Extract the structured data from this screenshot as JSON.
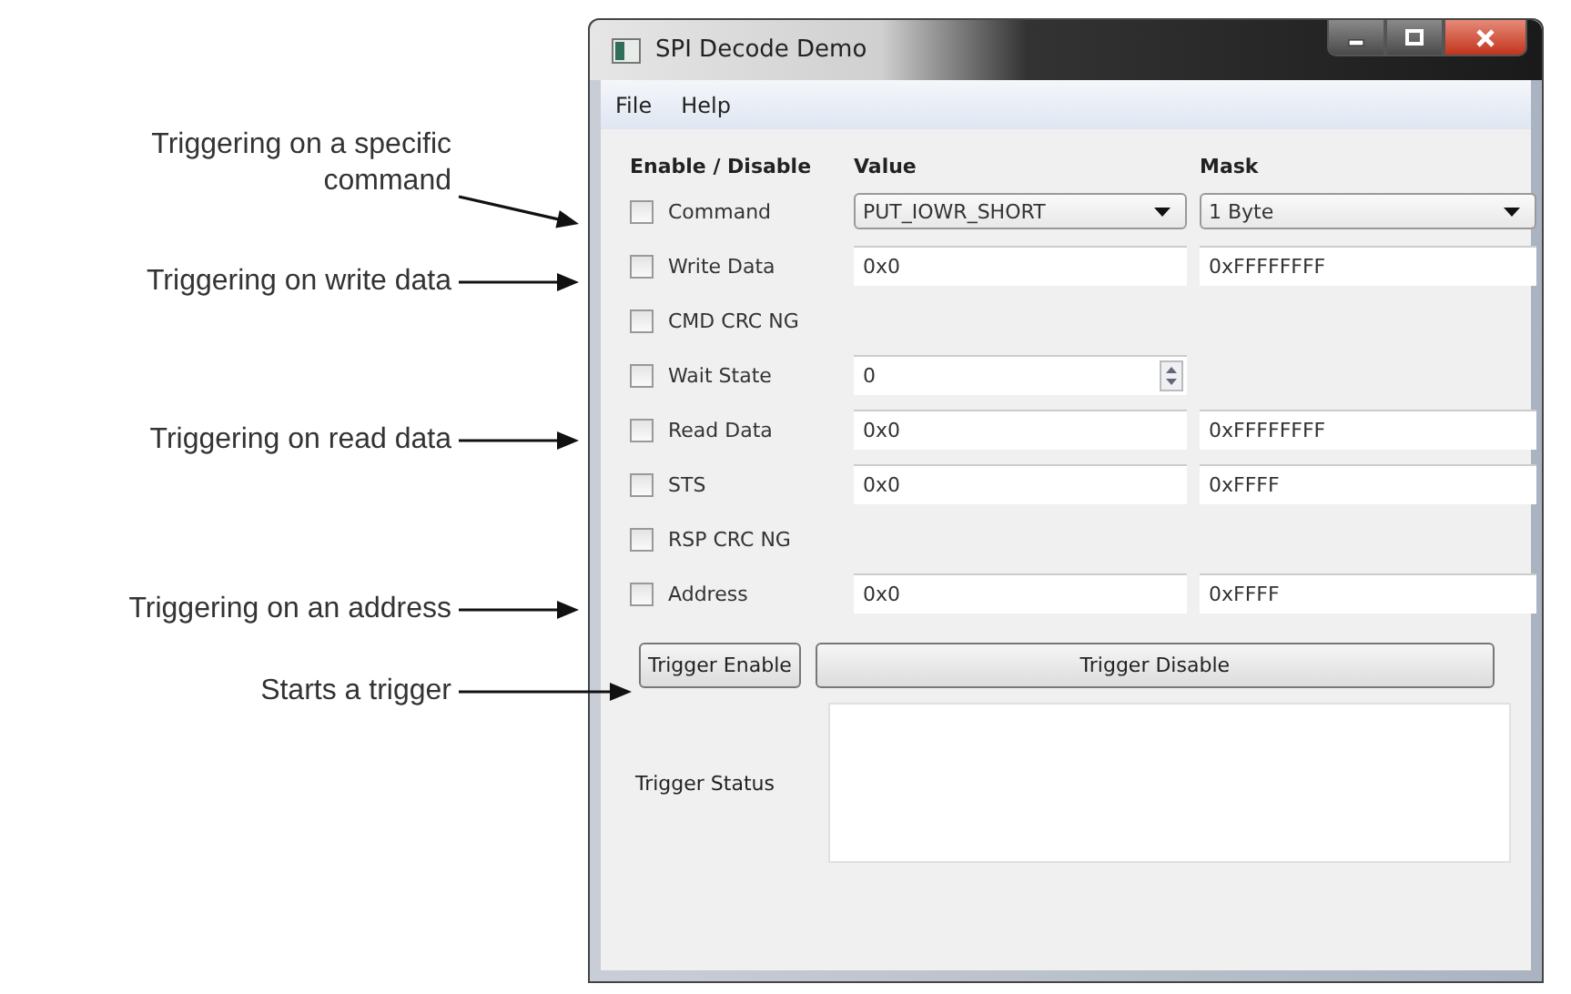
{
  "callouts": [
    {
      "text": "Triggering on a specific command"
    },
    {
      "text": "Triggering on write data"
    },
    {
      "text": "Triggering on read data"
    },
    {
      "text": "Triggering on an address"
    },
    {
      "text": "Starts a trigger"
    }
  ],
  "window": {
    "title": "SPI Decode Demo"
  },
  "menu": [
    "File",
    "Help"
  ],
  "columns": [
    "Enable / Disable",
    "Value",
    "Mask"
  ],
  "rows": [
    {
      "label": "Command",
      "checked": false,
      "kind": "dropdown",
      "value": "PUT_IOWR_SHORT",
      "mask": "1 Byte"
    },
    {
      "label": "Write Data",
      "checked": false,
      "kind": "text",
      "value": "0x0",
      "mask": "0xFFFFFFFF"
    },
    {
      "label": "CMD CRC NG",
      "checked": false,
      "kind": "none"
    },
    {
      "label": "Wait State",
      "checked": false,
      "kind": "spin",
      "value": "0"
    },
    {
      "label": "Read Data",
      "checked": false,
      "kind": "text",
      "value": "0x0",
      "mask": "0xFFFFFFFF"
    },
    {
      "label": "STS",
      "checked": false,
      "kind": "text",
      "value": "0x0",
      "mask": "0xFFFF"
    },
    {
      "label": "RSP CRC NG",
      "checked": false,
      "kind": "none"
    },
    {
      "label": "Address",
      "checked": false,
      "kind": "text",
      "value": "0x0",
      "mask": "0xFFFF"
    }
  ],
  "buttons": [
    "Trigger Enable",
    "Trigger Disable"
  ],
  "status": {
    "label": "Trigger Status"
  }
}
